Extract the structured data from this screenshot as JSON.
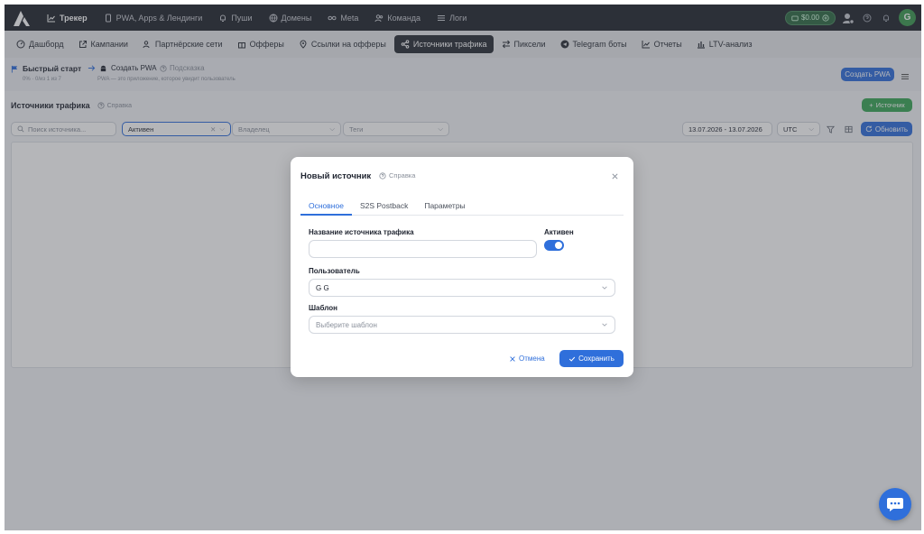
{
  "topnav": {
    "items": [
      {
        "label": "Трекер",
        "icon": "chart-line-icon",
        "active": true
      },
      {
        "label": "PWA, Apps & Лендинги",
        "icon": "phone-icon"
      },
      {
        "label": "Пуши",
        "icon": "bell-icon"
      },
      {
        "label": "Домены",
        "icon": "globe-icon"
      },
      {
        "label": "Meta",
        "icon": "infinity-icon"
      },
      {
        "label": "Команда",
        "icon": "users-icon"
      },
      {
        "label": "Логи",
        "icon": "list-icon"
      }
    ],
    "balance": "$0.00",
    "avatar_letter": "G"
  },
  "subnav": {
    "items": [
      {
        "label": "Дашборд",
        "icon": "dashboard-icon"
      },
      {
        "label": "Кампании",
        "icon": "external-link-icon"
      },
      {
        "label": "Партнёрские сети",
        "icon": "users-icon"
      },
      {
        "label": "Офферы",
        "icon": "gift-icon"
      },
      {
        "label": "Ссылки на офферы",
        "icon": "pin-icon"
      },
      {
        "label": "Источники трафика",
        "icon": "share-icon",
        "active": true
      },
      {
        "label": "Пиксели",
        "icon": "arrows-icon"
      },
      {
        "label": "Telegram боты",
        "icon": "telegram-icon"
      },
      {
        "label": "Отчеты",
        "icon": "chart-line-icon"
      },
      {
        "label": "LTV-анализ",
        "icon": "bar-chart-icon"
      }
    ]
  },
  "quickstart": {
    "title": "Быстрый старт",
    "progress": "0% · 0/из 1 из 7",
    "step": "Создать PWA",
    "hint": "Подсказка",
    "description": "PWA — это приложение, которое увидит пользователь",
    "create_button": "Создать PWA"
  },
  "page": {
    "title": "Источники трафика",
    "help": "Справка",
    "add_button": "Источник"
  },
  "filters": {
    "search_placeholder": "Поиск источника...",
    "status_value": "Активен",
    "owner_placeholder": "Владелец",
    "tags_placeholder": "Теги",
    "date_range": "13.07.2026 - 13.07.2026",
    "timezone": "UTC",
    "refresh_button": "Обновить"
  },
  "modal": {
    "title": "Новый источник",
    "help": "Справка",
    "tabs": [
      "Основное",
      "S2S Postback",
      "Параметры"
    ],
    "name_label": "Название источника трафика",
    "name_value": "",
    "active_label": "Активен",
    "active": true,
    "user_label": "Пользователь",
    "user_value": "G G",
    "template_label": "Шаблон",
    "template_placeholder": "Выберите шаблон",
    "cancel_button": "Отмена",
    "save_button": "Сохранить"
  },
  "colors": {
    "accent": "#2f6fdb",
    "nav_bg": "#23272f",
    "success": "#3aa757"
  }
}
